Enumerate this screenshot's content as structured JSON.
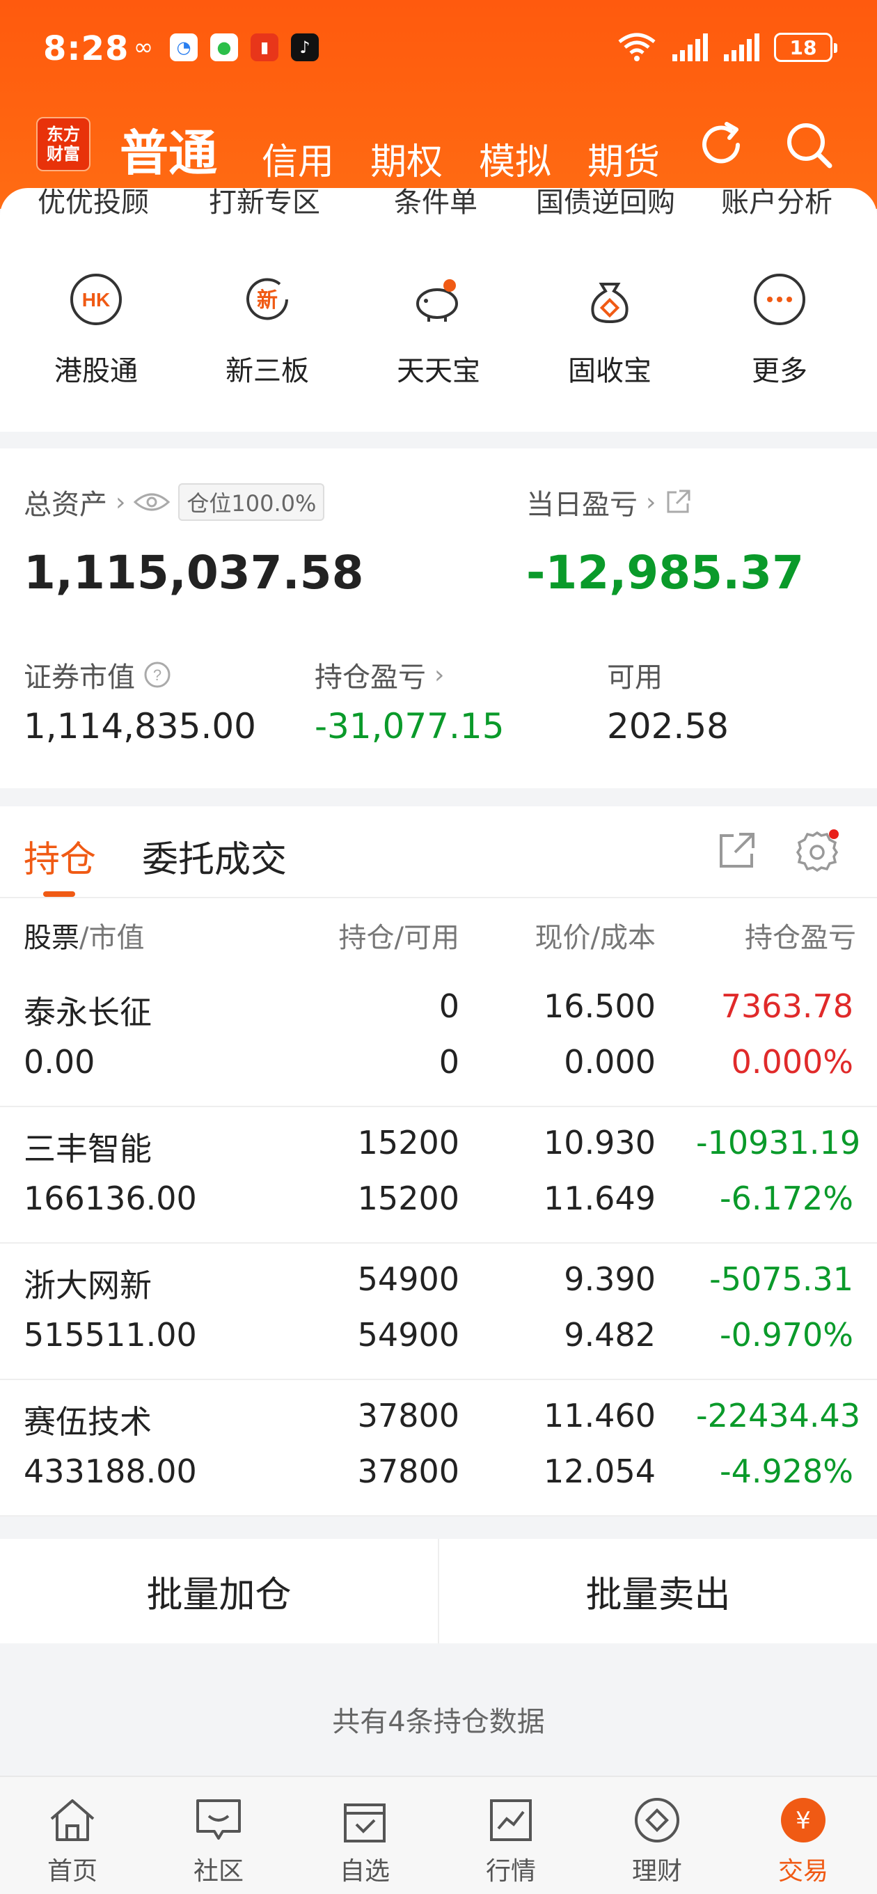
{
  "status": {
    "time": "8:28",
    "battery": "18"
  },
  "nav": {
    "logo_line1": "东方",
    "logo_line2": "财富",
    "main": "普通",
    "tabs": [
      "信用",
      "期权",
      "模拟",
      "期货"
    ]
  },
  "quick_top": [
    "优优投顾",
    "打新专区",
    "条件单",
    "国债逆回购",
    "账户分析"
  ],
  "quick_icons": [
    {
      "label": "港股通",
      "glyph": "HK",
      "icon": "hk-icon"
    },
    {
      "label": "新三板",
      "glyph": "新",
      "icon": "new-board-icon"
    },
    {
      "label": "天天宝",
      "icon": "piggy-bank-icon"
    },
    {
      "label": "固收宝",
      "icon": "money-bag-icon"
    },
    {
      "label": "更多",
      "icon": "more-icon"
    }
  ],
  "assets": {
    "total_label": "总资产",
    "position_badge": "仓位100.0%",
    "total_value": "1,115,037.58",
    "daily_label": "当日盈亏",
    "daily_value": "-12,985.37",
    "market_label": "证券市值",
    "market_value": "1,114,835.00",
    "hold_pl_label": "持仓盈亏",
    "hold_pl_value": "-31,077.15",
    "avail_label": "可用",
    "avail_value": "202.58"
  },
  "holdings": {
    "tab_active": "持仓",
    "tab_other": "委托成交",
    "col_stock": "股票",
    "col_stock_sub": "/市值",
    "col_qty": "持仓/可用",
    "col_price": "现价/成本",
    "col_pl": "持仓盈亏",
    "rows": [
      {
        "name": "泰永长征",
        "value": "0.00",
        "qty": "0",
        "avail": "0",
        "price": "16.500",
        "cost": "0.000",
        "pl": "7363.78",
        "pl_pct": "0.000%",
        "dir": "up"
      },
      {
        "name": "三丰智能",
        "value": "166136.00",
        "qty": "15200",
        "avail": "15200",
        "price": "10.930",
        "cost": "11.649",
        "pl": "-10931.19",
        "pl_pct": "-6.172%",
        "dir": "down"
      },
      {
        "name": "浙大网新",
        "value": "515511.00",
        "qty": "54900",
        "avail": "54900",
        "price": "9.390",
        "cost": "9.482",
        "pl": "-5075.31",
        "pl_pct": "-0.970%",
        "dir": "down"
      },
      {
        "name": "赛伍技术",
        "value": "433188.00",
        "qty": "37800",
        "avail": "37800",
        "price": "11.460",
        "cost": "12.054",
        "pl": "-22434.43",
        "pl_pct": "-4.928%",
        "dir": "down"
      }
    ]
  },
  "actions": {
    "add": "批量加仓",
    "sell": "批量卖出"
  },
  "summary": "共有4条持仓数据",
  "bottom_nav": [
    {
      "label": "首页",
      "icon": "home-icon"
    },
    {
      "label": "社区",
      "icon": "community-icon"
    },
    {
      "label": "自选",
      "icon": "watchlist-icon"
    },
    {
      "label": "行情",
      "icon": "market-icon"
    },
    {
      "label": "理财",
      "icon": "wealth-icon"
    },
    {
      "label": "交易",
      "icon": "trade-icon"
    }
  ],
  "colors": {
    "accent": "#f05a14",
    "up": "#e02a2a",
    "down": "#0a9a2a",
    "header": "#ff5a0e"
  }
}
